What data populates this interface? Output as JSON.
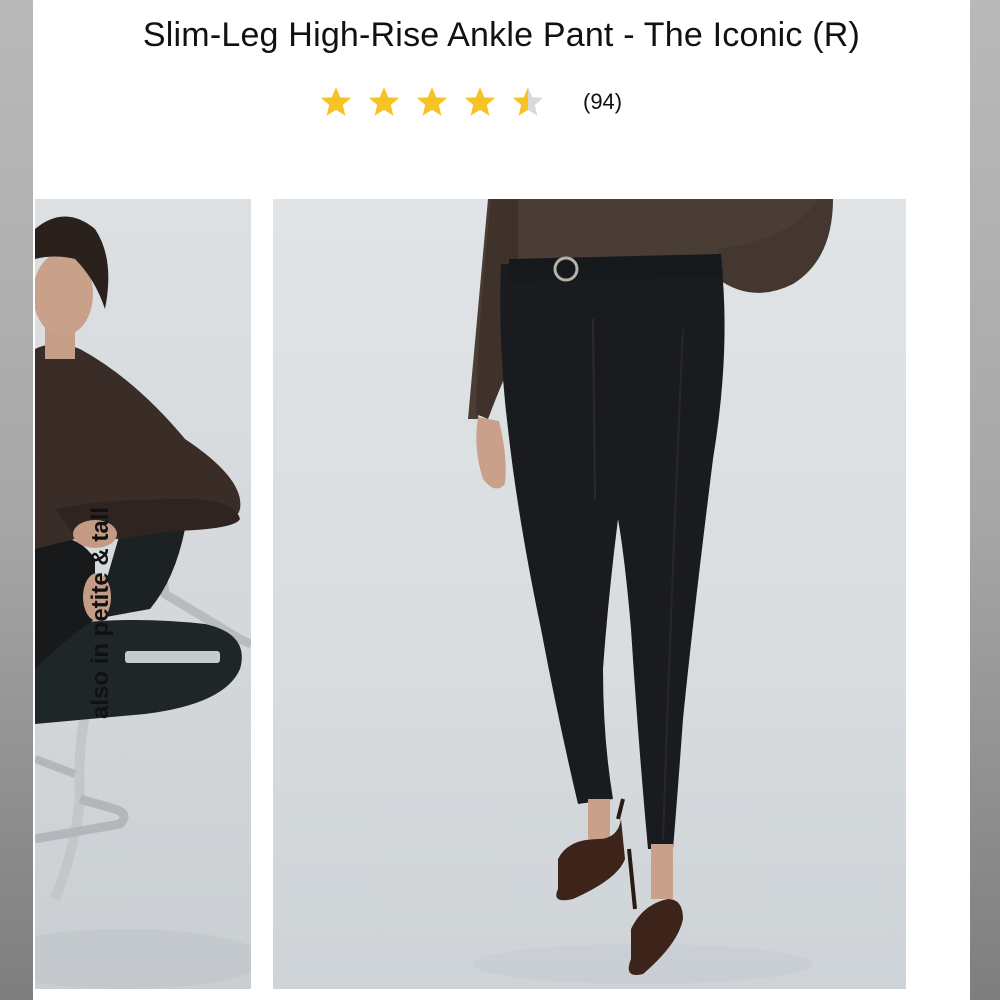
{
  "product": {
    "title": "Slim-Leg High-Rise Ankle Pant - The Iconic (R)",
    "rating": 4.5,
    "rating_max": 5,
    "review_count": "(94)",
    "star_color": "#F7C325",
    "star_empty_color": "#D9D9D9"
  },
  "gallery": {
    "thumbnail_overlay_text": "also in petite & tall",
    "thumbnail_icon": "model-seated-chair-photo",
    "main_icon": "model-pants-front-photo"
  }
}
